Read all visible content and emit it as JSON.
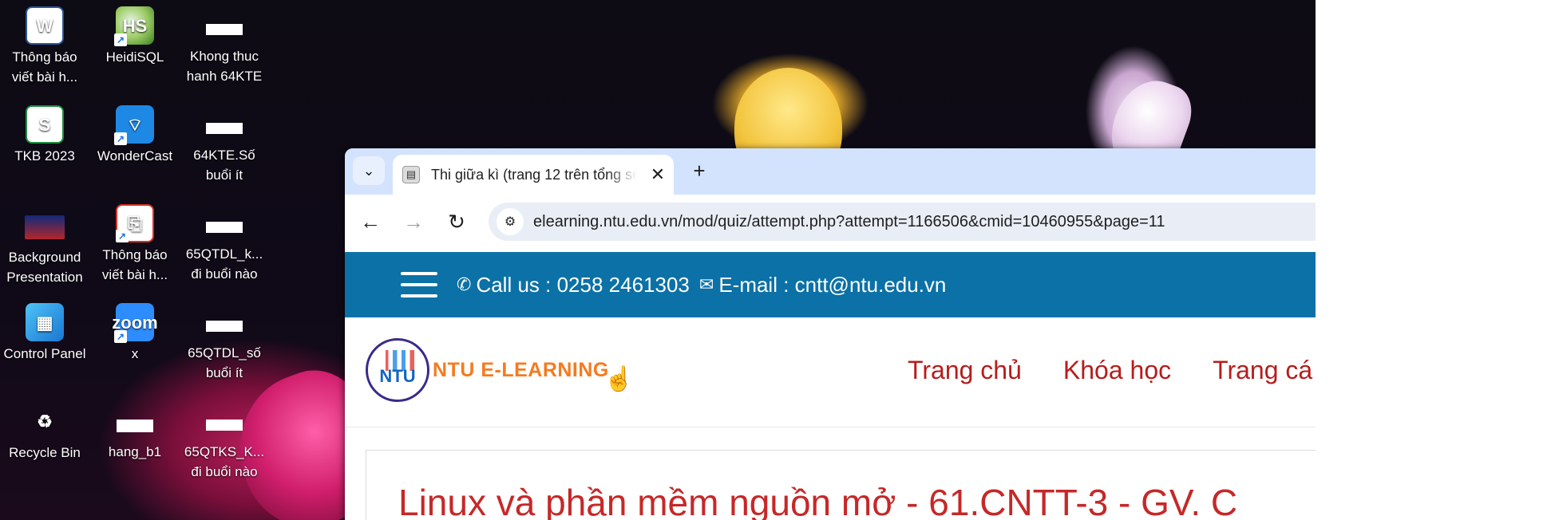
{
  "desktop": {
    "icons": [
      {
        "label": "Thông báo viết bài h...",
        "icon": "word-doc-icon"
      },
      {
        "label": "HeidiSQL",
        "icon": "heidisql-icon"
      },
      {
        "label": "Khong thuc hanh 64KTE",
        "icon": "blank-file-icon"
      },
      {
        "label": "TKB 2023",
        "icon": "spreadsheet-icon"
      },
      {
        "label": "WonderCast",
        "icon": "wondercast-icon"
      },
      {
        "label": "64KTE.Số buổi ít",
        "icon": "blank-file-icon"
      },
      {
        "label": "Background Presentation",
        "icon": "presentation-image-icon"
      },
      {
        "label": "Thông báo viết bài h...",
        "icon": "pdf-icon"
      },
      {
        "label": "65QTDL_k... đi buổi nào",
        "icon": "blank-file-icon"
      },
      {
        "label": "Control Panel",
        "icon": "control-panel-icon"
      },
      {
        "label": "x",
        "icon": "zoom-icon"
      },
      {
        "label": "65QTDL_số buổi ít",
        "icon": "blank-file-icon"
      },
      {
        "label": "Recycle Bin",
        "icon": "recycle-bin-icon"
      },
      {
        "label": "hang_b1",
        "icon": "image-file-icon"
      },
      {
        "label": "65QTKS_K... đi buổi nào",
        "icon": "blank-file-icon"
      }
    ],
    "heidi_badge": "HS",
    "zoom_badge": "zoom"
  },
  "browser": {
    "tab": {
      "title": "Thi giữa kì (trang 12 trên tổng số",
      "close_glyph": "✕"
    },
    "tab_list_glyph": "⌄",
    "new_tab_glyph": "+",
    "url": "elearning.ntu.edu.vn/mod/quiz/attempt.php?attempt=1166506&cmid=10460955&page=11"
  },
  "page": {
    "header": {
      "phone": "Call us : 0258 2461303",
      "email": "E-mail : cntt@ntu.edu.vn"
    },
    "logo": {
      "emblem_text": "NTU",
      "text": "NTU E-LEARNING"
    },
    "menu": [
      "Trang chủ",
      "Khóa học",
      "Trang cá"
    ],
    "course_title": "Linux và phần mềm nguồn mở - 61.CNTT-3 - GV. C"
  },
  "colors": {
    "header_bg": "#0b71a6",
    "menu_text": "#b71c1c",
    "logo_text": "#f47b20",
    "tabstrip_bg": "#d3e3fd"
  }
}
